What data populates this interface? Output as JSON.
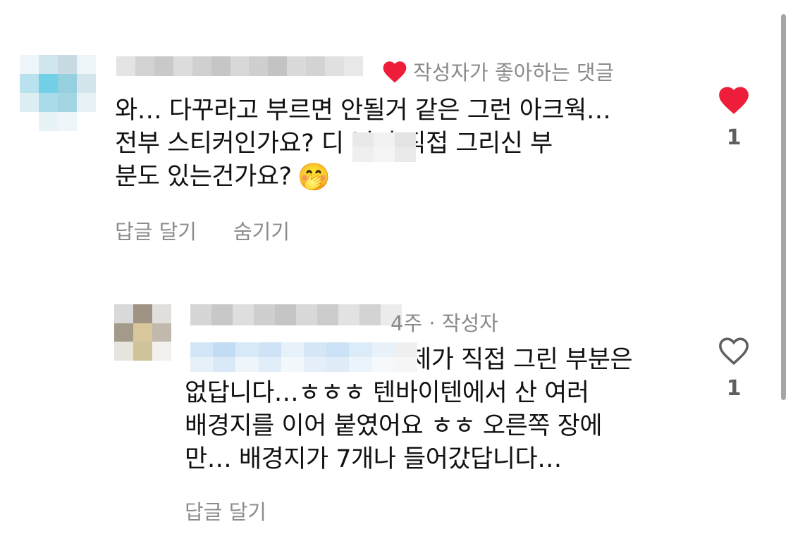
{
  "comment1": {
    "author_liked_label": "작성자가 좋아하는 댓글",
    "text_lines": [
      "와… 다꾸라고 부르면 안될거 같은 그런 아크웍…",
      "전부 스티커인가요? 디     님이 직접 그리신 부",
      "분도 있는건가요?"
    ],
    "reply_label": "답글 달기",
    "hide_label": "숨기기",
    "like_count": "1",
    "liked": true,
    "emoji": "🤭"
  },
  "comment2": {
    "meta": "4주 · 작성자",
    "text_lines": [
      "제가 직접 그린 부분은",
      "없답니다…ㅎㅎㅎ 텐바이텐에서 산 여러",
      "배경지를 이어 붙였어요 ㅎㅎ 오른쪽 장에",
      "만… 배경지가 7개나 들어갔답니다…"
    ],
    "reply_label": "답글 달기",
    "like_count": "1",
    "liked": false
  },
  "colors": {
    "heart_red": "#ee1d3a",
    "muted_text": "#8a8a8a",
    "like_count": "#5f5f5f"
  }
}
